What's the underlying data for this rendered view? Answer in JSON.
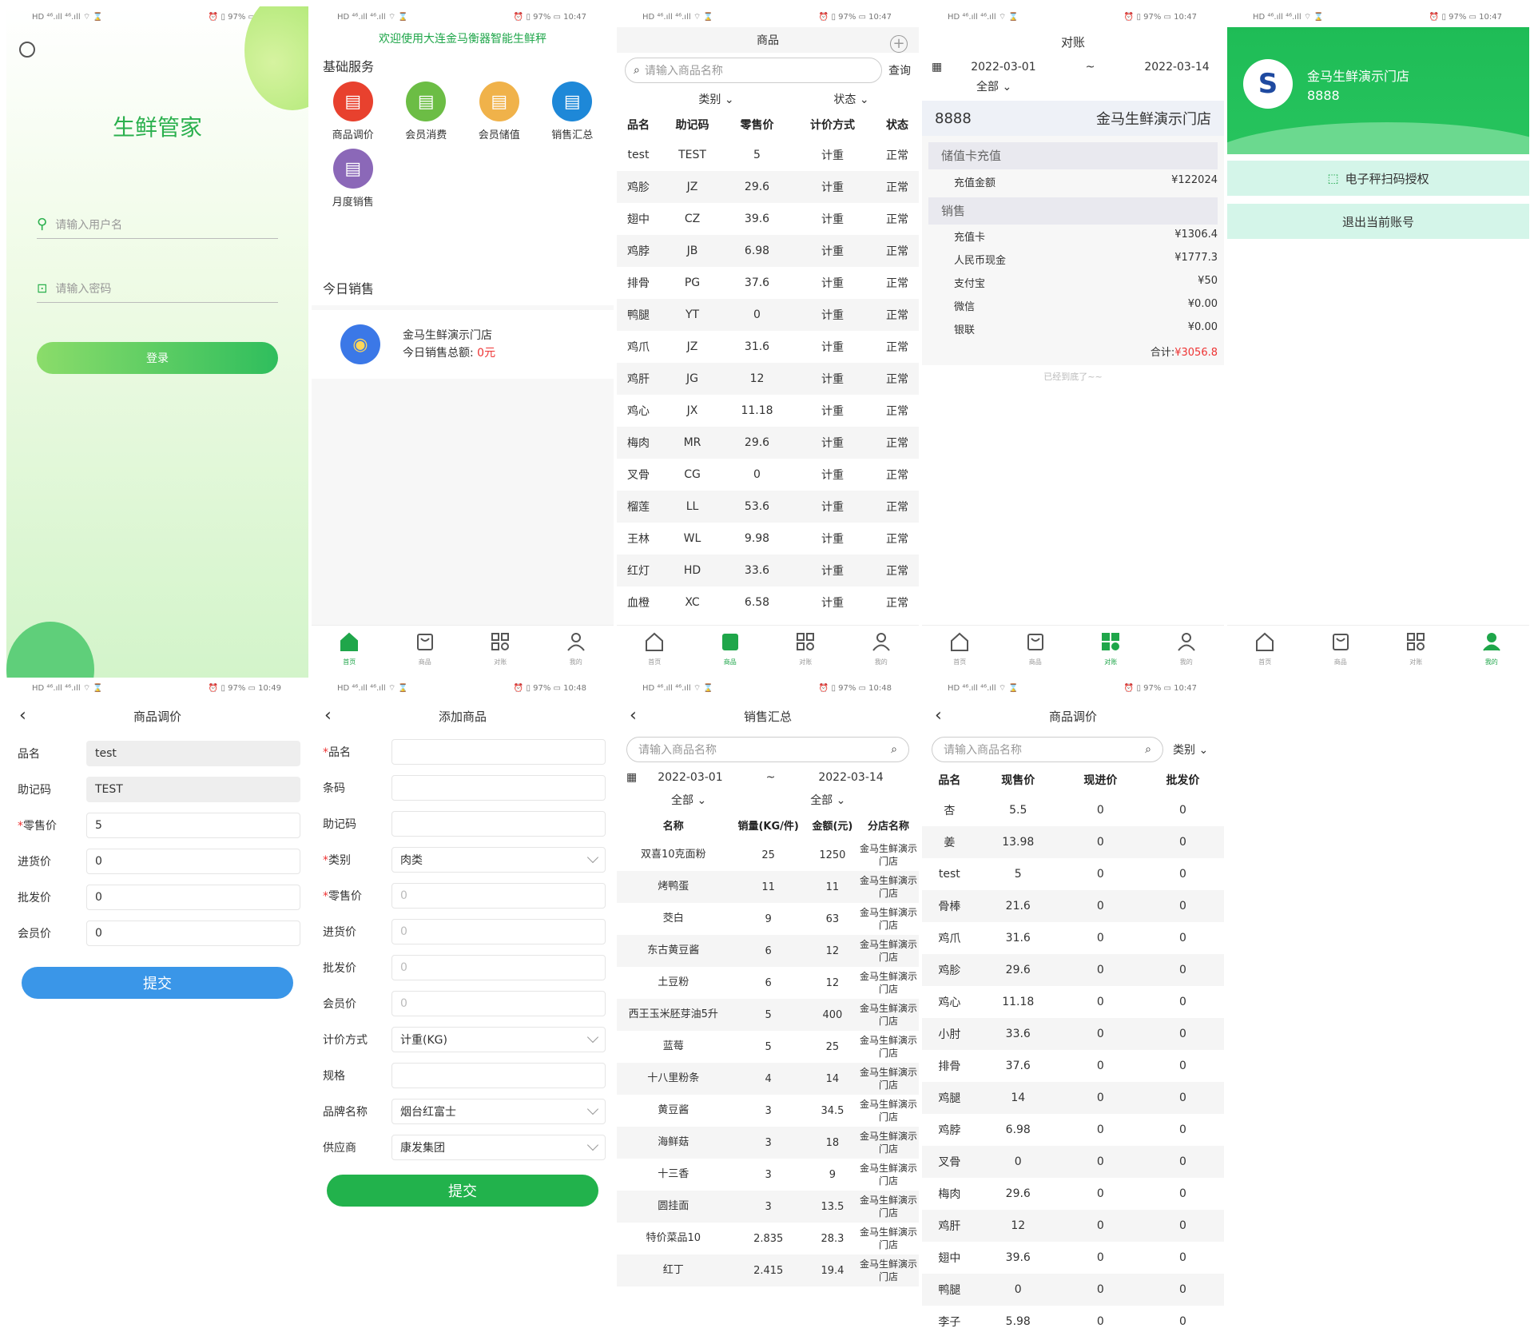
{
  "status": {
    "left": "HD ⁴⁶.ıll ⁴⁶.ıll ⌔ ⌛",
    "right": "⏰ ▯ 97% ▭ 10:47",
    "right_b": "⏰ ▯ 97% ▭ 10:49",
    "right_c": "⏰ ▯ 97% ▭ 10:48",
    "right_d": "⏰ ▯ 97% ▭ 10:48"
  },
  "tabs": [
    {
      "label": "首页"
    },
    {
      "label": "商品"
    },
    {
      "label": "对账"
    },
    {
      "label": "我的"
    }
  ],
  "login": {
    "title": "生鲜管家",
    "username_placeholder": "请输入用户名",
    "password_placeholder": "请输入密码",
    "login_label": "登录"
  },
  "home": {
    "welcome": "欢迎使用大连金马衡器智能生鲜秤",
    "basic_title": "基础服务",
    "services": [
      {
        "label": "商品调价",
        "color": "#e8412e"
      },
      {
        "label": "会员消费",
        "color": "#6cbd45"
      },
      {
        "label": "会员储值",
        "color": "#f0b24a"
      },
      {
        "label": "销售汇总",
        "color": "#1e88d8"
      },
      {
        "label": "月度销售",
        "color": "#8b68b8"
      }
    ],
    "today_title": "今日销售",
    "store_name": "金马生鲜演示门店",
    "sales_label": "今日销售总额:",
    "sales_value": "0元"
  },
  "products": {
    "title": "商品",
    "search_placeholder": "请输入商品名称",
    "search_btn": "查询",
    "filter_category": "类别",
    "filter_status": "状态",
    "columns": [
      "品名",
      "助记码",
      "零售价",
      "计价方式",
      "状态"
    ],
    "rows": [
      [
        "test",
        "TEST",
        "5",
        "计重",
        "正常"
      ],
      [
        "鸡胗",
        "JZ",
        "29.6",
        "计重",
        "正常"
      ],
      [
        "翅中",
        "CZ",
        "39.6",
        "计重",
        "正常"
      ],
      [
        "鸡脖",
        "JB",
        "6.98",
        "计重",
        "正常"
      ],
      [
        "排骨",
        "PG",
        "37.6",
        "计重",
        "正常"
      ],
      [
        "鸭腿",
        "YT",
        "0",
        "计重",
        "正常"
      ],
      [
        "鸡爪",
        "JZ",
        "31.6",
        "计重",
        "正常"
      ],
      [
        "鸡肝",
        "JG",
        "12",
        "计重",
        "正常"
      ],
      [
        "鸡心",
        "JX",
        "11.18",
        "计重",
        "正常"
      ],
      [
        "梅肉",
        "MR",
        "29.6",
        "计重",
        "正常"
      ],
      [
        "叉骨",
        "CG",
        "0",
        "计重",
        "正常"
      ],
      [
        "榴莲",
        "LL",
        "53.6",
        "计重",
        "正常"
      ],
      [
        "王林",
        "WL",
        "9.98",
        "计重",
        "正常"
      ],
      [
        "红灯",
        "HD",
        "33.6",
        "计重",
        "正常"
      ],
      [
        "血橙",
        "XC",
        "6.58",
        "计重",
        "正常"
      ]
    ]
  },
  "recon": {
    "title": "对账",
    "date_from": "2022-03-01",
    "date_sep": "~",
    "date_to": "2022-03-14",
    "filter": "全部",
    "store_id": "8888",
    "store_name": "金马生鲜演示门店",
    "card_section": "储值卡充值",
    "card_label": "充值金额",
    "card_value": "¥122024",
    "sales_section": "销售",
    "items": [
      {
        "label": "充值卡",
        "value": "¥1306.4"
      },
      {
        "label": "人民币现金",
        "value": "¥1777.3"
      },
      {
        "label": "支付宝",
        "value": "¥50"
      },
      {
        "label": "微信",
        "value": "¥0.00"
      },
      {
        "label": "银联",
        "value": "¥0.00"
      }
    ],
    "total_label": "合计:",
    "total_value": "¥3056.8",
    "end_note": "已经到底了~~"
  },
  "mine": {
    "store_name": "金马生鲜演示门店",
    "store_id": "8888",
    "scan_label": "电子秤扫码授权",
    "logout_label": "退出当前账号"
  },
  "edit": {
    "title": "商品调价",
    "fields": [
      {
        "label": "品名",
        "value": "test",
        "req": "",
        "ro": true
      },
      {
        "label": "助记码",
        "value": "TEST",
        "req": "",
        "ro": true
      },
      {
        "label": "零售价",
        "value": "5",
        "req": "*",
        "ro": false
      },
      {
        "label": "进货价",
        "value": "0",
        "req": "",
        "ro": false
      },
      {
        "label": "批发价",
        "value": "0",
        "req": "",
        "ro": false
      },
      {
        "label": "会员价",
        "value": "0",
        "req": "",
        "ro": false
      }
    ],
    "submit": "提交"
  },
  "add": {
    "title": "添加商品",
    "fields": [
      {
        "label": "品名",
        "req": "*",
        "value": "",
        "ph": "",
        "sel": false
      },
      {
        "label": "条码",
        "req": "",
        "value": "",
        "ph": "",
        "sel": false
      },
      {
        "label": "助记码",
        "req": "",
        "value": "",
        "ph": "",
        "sel": false
      },
      {
        "label": "类别",
        "req": "*",
        "value": "肉类",
        "ph": "",
        "sel": true
      },
      {
        "label": "零售价",
        "req": "*",
        "value": "",
        "ph": "0",
        "sel": false
      },
      {
        "label": "进货价",
        "req": "",
        "value": "",
        "ph": "0",
        "sel": false
      },
      {
        "label": "批发价",
        "req": "",
        "value": "",
        "ph": "0",
        "sel": false
      },
      {
        "label": "会员价",
        "req": "",
        "value": "",
        "ph": "0",
        "sel": false
      },
      {
        "label": "计价方式",
        "req": "",
        "value": "计重(KG)",
        "ph": "",
        "sel": true
      },
      {
        "label": "规格",
        "req": "",
        "value": "",
        "ph": "",
        "sel": false
      },
      {
        "label": "品牌名称",
        "req": "",
        "value": "烟台红富士",
        "ph": "",
        "sel": true
      },
      {
        "label": "供应商",
        "req": "",
        "value": "康发集团",
        "ph": "",
        "sel": true
      }
    ],
    "submit": "提交"
  },
  "summary": {
    "title": "销售汇总",
    "search_placeholder": "请输入商品名称",
    "date_from": "2022-03-01",
    "date_sep": "~",
    "date_to": "2022-03-14",
    "filter1": "全部",
    "filter2": "全部",
    "columns": [
      "名称",
      "销量(KG/件)",
      "金额(元)",
      "分店名称"
    ],
    "rows": [
      [
        "双喜10克面粉",
        "25",
        "1250",
        "金马生鲜演示门店"
      ],
      [
        "烤鸭蛋",
        "11",
        "11",
        "金马生鲜演示门店"
      ],
      [
        "茭白",
        "9",
        "63",
        "金马生鲜演示门店"
      ],
      [
        "东古黄豆酱",
        "6",
        "12",
        "金马生鲜演示门店"
      ],
      [
        "土豆粉",
        "6",
        "12",
        "金马生鲜演示门店"
      ],
      [
        "西王玉米胚芽油5升",
        "5",
        "400",
        "金马生鲜演示门店"
      ],
      [
        "蓝莓",
        "5",
        "25",
        "金马生鲜演示门店"
      ],
      [
        "十八里粉条",
        "4",
        "14",
        "金马生鲜演示门店"
      ],
      [
        "黄豆酱",
        "3",
        "34.5",
        "金马生鲜演示门店"
      ],
      [
        "海鲜菇",
        "3",
        "18",
        "金马生鲜演示门店"
      ],
      [
        "十三香",
        "3",
        "9",
        "金马生鲜演示门店"
      ],
      [
        "圆挂面",
        "3",
        "13.5",
        "金马生鲜演示门店"
      ],
      [
        "特价菜品10",
        "2.835",
        "28.3",
        "金马生鲜演示门店"
      ],
      [
        "红丁",
        "2.415",
        "19.4",
        "金马生鲜演示门店"
      ]
    ]
  },
  "price": {
    "title": "商品调价",
    "search_placeholder": "请输入商品名称",
    "filter": "类别",
    "columns": [
      "品名",
      "现售价",
      "现进价",
      "批发价"
    ],
    "rows": [
      [
        "杏",
        "5.5",
        "0",
        "0"
      ],
      [
        "姜",
        "13.98",
        "0",
        "0"
      ],
      [
        "test",
        "5",
        "0",
        "0"
      ],
      [
        "骨棒",
        "21.6",
        "0",
        "0"
      ],
      [
        "鸡爪",
        "31.6",
        "0",
        "0"
      ],
      [
        "鸡胗",
        "29.6",
        "0",
        "0"
      ],
      [
        "鸡心",
        "11.18",
        "0",
        "0"
      ],
      [
        "小肘",
        "33.6",
        "0",
        "0"
      ],
      [
        "排骨",
        "37.6",
        "0",
        "0"
      ],
      [
        "鸡腿",
        "14",
        "0",
        "0"
      ],
      [
        "鸡脖",
        "6.98",
        "0",
        "0"
      ],
      [
        "叉骨",
        "0",
        "0",
        "0"
      ],
      [
        "梅肉",
        "29.6",
        "0",
        "0"
      ],
      [
        "鸡肝",
        "12",
        "0",
        "0"
      ],
      [
        "翅中",
        "39.6",
        "0",
        "0"
      ],
      [
        "鸭腿",
        "0",
        "0",
        "0"
      ],
      [
        "李子",
        "5.98",
        "0",
        "0"
      ]
    ]
  }
}
